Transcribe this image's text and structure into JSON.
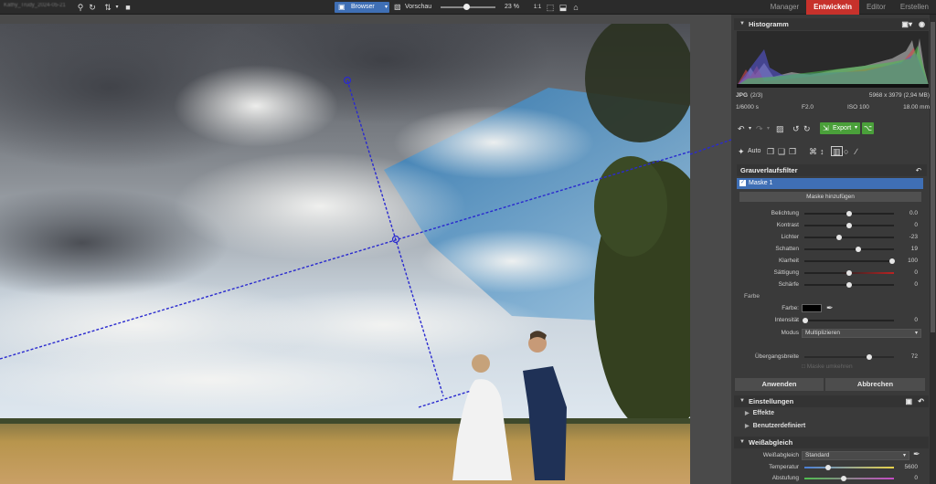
{
  "topbar": {
    "path": "Kathy_Trudy_2024-05-21",
    "browser_label": "Browser",
    "vorschau_label": "Vorschau",
    "zoom": "23 %",
    "zoom_fraction": 0.45,
    "tabs": [
      {
        "label": "Manager",
        "active": false
      },
      {
        "label": "Entwickeln",
        "active": true
      },
      {
        "label": "Editor",
        "active": false
      },
      {
        "label": "Erstellen",
        "active": false
      }
    ]
  },
  "histogram": {
    "title": "Histogramm"
  },
  "meta": {
    "format": "JPG",
    "index": "(2/3)",
    "dimensions": "5968 x 3979 (2,94 MB)",
    "shutter": "1/6000 s",
    "aperture": "F2.0",
    "iso": "ISO 100",
    "focal": "18.00 mm"
  },
  "toolbar": {
    "export_label": "Export",
    "auto_label": "Auto"
  },
  "filter": {
    "title": "Grauverlaufsfilter",
    "mask_label": "Maske 1",
    "add_mask_label": "Maske hinzufügen",
    "sliders": [
      {
        "label": "Belichtung",
        "value": "0.0",
        "pos": 0.5
      },
      {
        "label": "Kontrast",
        "value": "0",
        "pos": 0.5
      },
      {
        "label": "Lichter",
        "value": "-23",
        "pos": 0.39
      },
      {
        "label": "Schatten",
        "value": "19",
        "pos": 0.6
      },
      {
        "label": "Klarheit",
        "value": "100",
        "pos": 0.98
      },
      {
        "label": "Sättigung",
        "value": "0",
        "pos": 0.5
      },
      {
        "label": "Schärfe",
        "value": "0",
        "pos": 0.5
      }
    ],
    "farbe_section": "Farbe",
    "farbe_label": "Farbe:",
    "intensitaet_label": "Intensität",
    "intensitaet_value": "0",
    "modus_label": "Modus",
    "modus_value": "Multiplizieren",
    "uebergang_label": "Übergangsbreite",
    "uebergang_value": "72",
    "uebergang_pos": 0.72,
    "invert_label": "Maske umkehren",
    "apply_label": "Anwenden",
    "cancel_label": "Abbrechen"
  },
  "settings": {
    "title": "Einstellungen",
    "items": [
      "Effekte",
      "Benutzerdefiniert"
    ]
  },
  "wb": {
    "title": "Weißabgleich",
    "label": "Weißabgleich",
    "value": "Standard",
    "temp_label": "Temperatur",
    "temp_value": "5600",
    "tint_label": "Abstufung",
    "tint_value": "0"
  },
  "colors": {
    "accent_red": "#c7312b",
    "accent_blue": "#3f6fb5",
    "export_green": "#4aa03a",
    "gradient_line": "#2a2acf"
  }
}
